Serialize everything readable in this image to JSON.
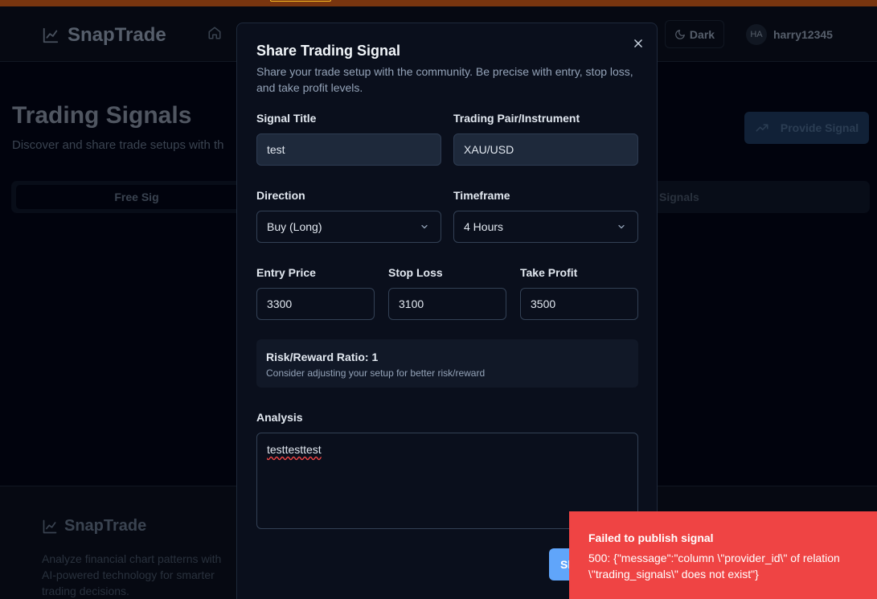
{
  "colors": {
    "accent": "#60a5fa",
    "toast_error": "#ef4444",
    "background": "#020617",
    "modal": "#0a0f1c"
  },
  "navbar": {
    "brand": "SnapTrade",
    "brand_icon": "chart-line-icon",
    "home_icon": "home-icon",
    "theme_label": "Dark",
    "theme_icon": "moon-icon",
    "avatar_initials": "HA",
    "username": "harry12345"
  },
  "page": {
    "title": "Trading Signals",
    "subtitle": "Discover and share trade setups with th",
    "provide_button": "Provide Signal",
    "provide_icon": "trending-up-icon",
    "tabs": [
      {
        "label": "Free Sig"
      },
      {
        "label": "Signals"
      }
    ]
  },
  "footer": {
    "brand": "SnapTrade",
    "description": "Analyze financial chart patterns with AI-powered technology for smarter trading decisions."
  },
  "modal": {
    "title": "Share Trading Signal",
    "description": "Share your trade setup with the community. Be precise with entry, stop loss, and take profit levels.",
    "close_icon": "close-icon",
    "fields": {
      "signal_title": {
        "label": "Signal Title",
        "value": "test"
      },
      "pair": {
        "label": "Trading Pair/Instrument",
        "value": "XAU/USD"
      },
      "direction": {
        "label": "Direction",
        "value": "Buy (Long)"
      },
      "timeframe": {
        "label": "Timeframe",
        "value": "4 Hours"
      },
      "entry": {
        "label": "Entry Price",
        "value": "3300"
      },
      "stop": {
        "label": "Stop Loss",
        "value": "3100"
      },
      "take": {
        "label": "Take Profit",
        "value": "3500"
      },
      "analysis": {
        "label": "Analysis",
        "value": "testtesttest"
      }
    },
    "risk_reward": {
      "title": "Risk/Reward Ratio: 1",
      "note": "Consider adjusting your setup for better risk/reward"
    },
    "submit_label": "Sh"
  },
  "toast": {
    "title": "Failed to publish signal",
    "message": "500: {\"message\":\"column \\\"provider_id\\\" of relation \\\"trading_signals\\\" does not exist\"}"
  }
}
